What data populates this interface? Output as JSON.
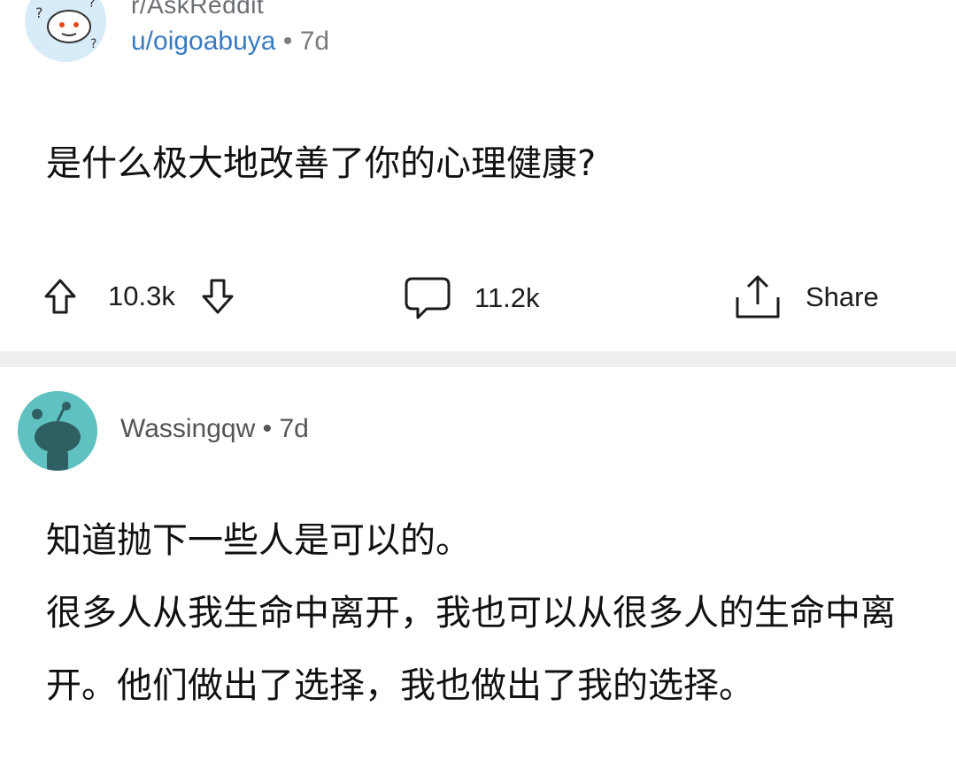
{
  "post": {
    "subreddit": "r/AskReddit",
    "username": "u/oigoabuya",
    "separator": "•",
    "age": "7d",
    "title": "是什么极大地改善了你的心理健康?",
    "upvotes": "10.3k",
    "comments": "11.2k",
    "share_label": "Share"
  },
  "comment": {
    "username": "Wassingqw",
    "separator": "•",
    "age": "7d",
    "lines": [
      "知道抛下一些人是可以的。",
      "很多人从我生命中离开，我也可以从很多人的生命中离开。他们做出了选择，我也做出了我的选择。"
    ]
  },
  "icons": {
    "op_avatar": "reddit-snoo-confused-icon",
    "upvote": "upvote-arrow-icon",
    "downvote": "downvote-arrow-icon",
    "comment": "comment-bubble-icon",
    "share": "share-icon",
    "commenter_avatar": "reddit-snoo-default-icon"
  },
  "colors": {
    "username_link": "#3a7bbf",
    "commenter_avatar_bg": "#5fc2c0",
    "op_avatar_bg": "#d7ecf7",
    "divider": "#eeeeee"
  }
}
